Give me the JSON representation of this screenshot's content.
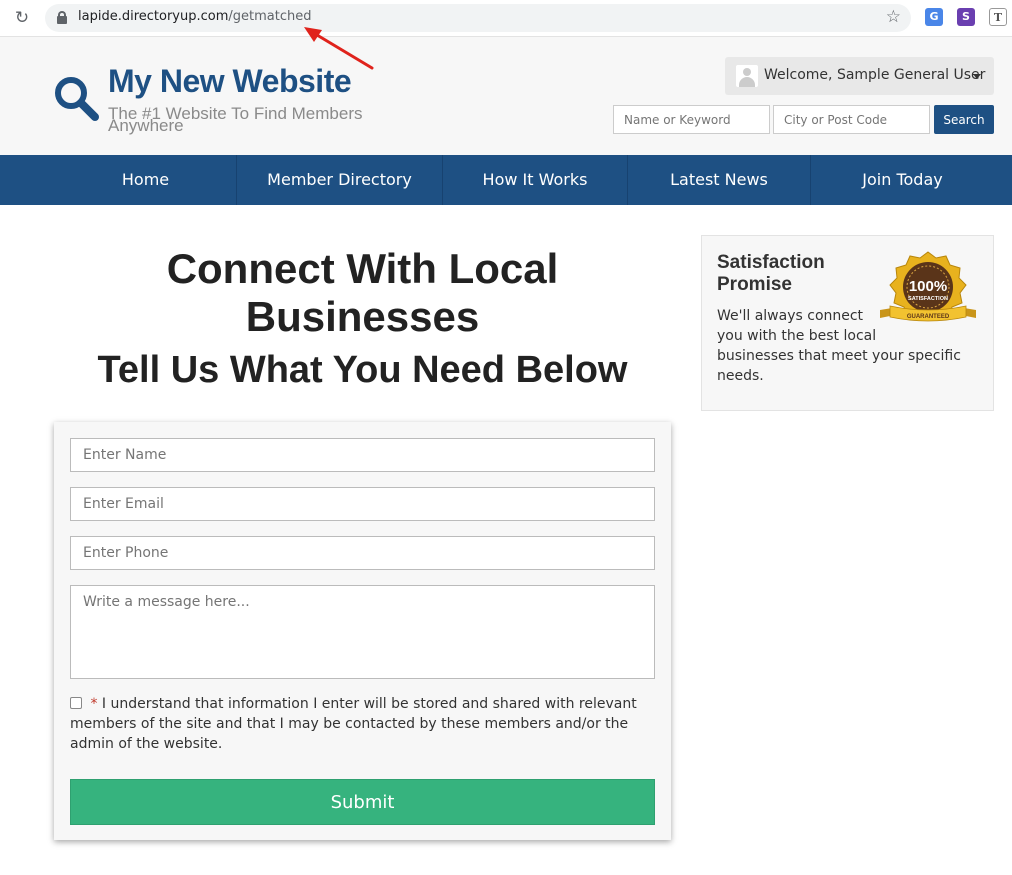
{
  "browser": {
    "url_host": "lapide.directoryup.com",
    "url_path": "/getmatched",
    "extensions": [
      "translate-extension-icon",
      "s-extension-icon",
      "t-extension-icon"
    ]
  },
  "header": {
    "site_title": "My New Website",
    "tagline": "The #1 Website To Find Members Anywhere",
    "welcome": "Welcome, Sample General User",
    "search": {
      "keyword_placeholder": "Name or Keyword",
      "location_placeholder": "City or Post Code",
      "button_label": "Search"
    }
  },
  "nav": {
    "items": [
      "Home",
      "Member Directory",
      "How It Works",
      "Latest News",
      "Join Today"
    ]
  },
  "main": {
    "title": "Connect With Local Businesses",
    "subtitle": "Tell Us What You Need Below",
    "form": {
      "name_placeholder": "Enter Name",
      "email_placeholder": "Enter Email",
      "phone_placeholder": "Enter Phone",
      "message_placeholder": "Write a message here...",
      "required_mark": "*",
      "consent_text": "I understand that information I enter will be stored and shared with relevant members of the site and that I may be contacted by these members and/or the admin of the website.",
      "submit_label": "Submit"
    }
  },
  "sidebar": {
    "title": "Satisfaction Promise",
    "text_line1": "We'll always connect you with the best local",
    "text_line2": "businesses that meet your specific needs.",
    "badge": {
      "percent": "100%",
      "label": "SATISFACTION",
      "ribbon": "GUARANTEED"
    }
  },
  "colors": {
    "brand_blue": "#1e5083",
    "submit_green": "#36b37e",
    "annotation_red": "#e0231c"
  }
}
